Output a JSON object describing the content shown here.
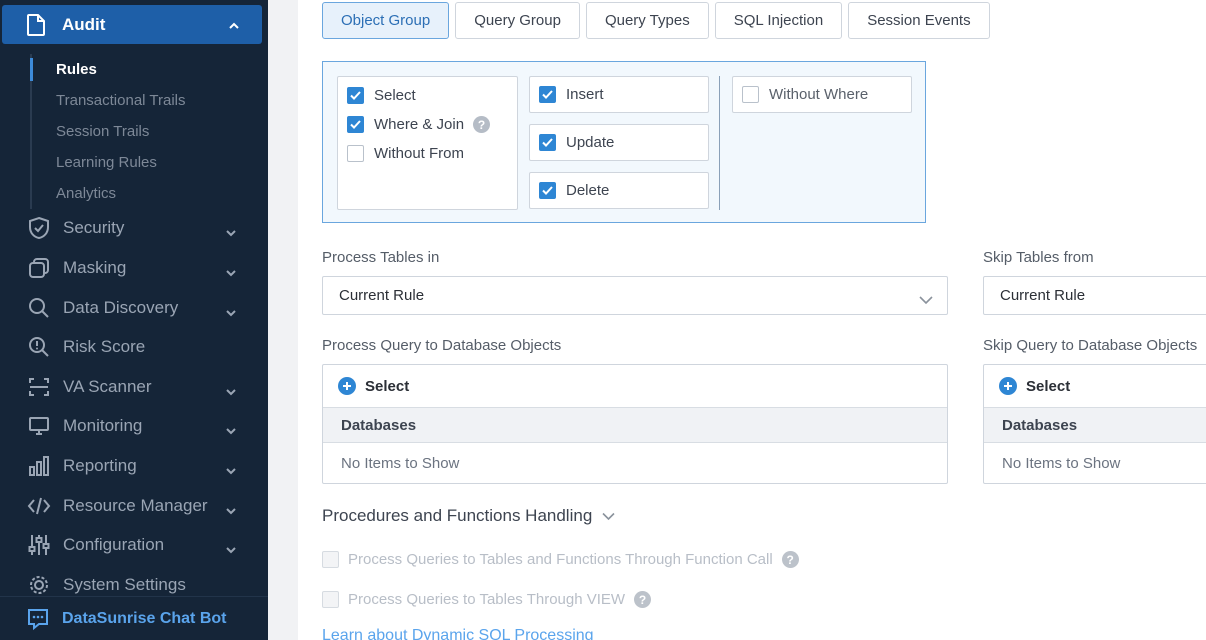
{
  "sidebar": {
    "audit": "Audit",
    "sub_items": [
      "Rules",
      "Transactional Trails",
      "Session Trails",
      "Learning Rules",
      "Analytics"
    ],
    "items": [
      {
        "label": "Security"
      },
      {
        "label": "Masking"
      },
      {
        "label": "Data Discovery"
      },
      {
        "label": "Risk Score"
      },
      {
        "label": "VA Scanner"
      },
      {
        "label": "Monitoring"
      },
      {
        "label": "Reporting"
      },
      {
        "label": "Resource Manager"
      },
      {
        "label": "Configuration"
      },
      {
        "label": "System Settings"
      }
    ],
    "chatbot": "DataSunrise Chat Bot"
  },
  "tabs": [
    "Object Group",
    "Query Group",
    "Query Types",
    "SQL Injection",
    "Session Events"
  ],
  "active_tab": "Object Group",
  "query_types": {
    "select": "Select",
    "where_join": "Where & Join",
    "without_from": "Without From",
    "insert": "Insert",
    "update": "Update",
    "delete": "Delete",
    "without_where": "Without Where",
    "help": "?"
  },
  "process_tables": {
    "label": "Process Tables in",
    "value": "Current Rule"
  },
  "skip_tables": {
    "label": "Skip Tables from",
    "value": "Current Rule"
  },
  "process_query": {
    "label": "Process Query to Database Objects",
    "select": "Select",
    "column": "Databases",
    "empty": "No Items to Show"
  },
  "skip_query": {
    "label": "Skip Query to Database Objects",
    "select": "Select",
    "column": "Databases",
    "empty": "No Items to Show"
  },
  "procedures": {
    "title": "Procedures and Functions Handling",
    "option1": "Process Queries to Tables and Functions Through Function Call",
    "option2": "Process Queries to Tables Through VIEW"
  },
  "link": "Learn about Dynamic SQL Processing",
  "colors": {
    "sidebar_bg": "#152538",
    "accent": "#2e86d4",
    "active_nav": "#1e5fa8"
  }
}
